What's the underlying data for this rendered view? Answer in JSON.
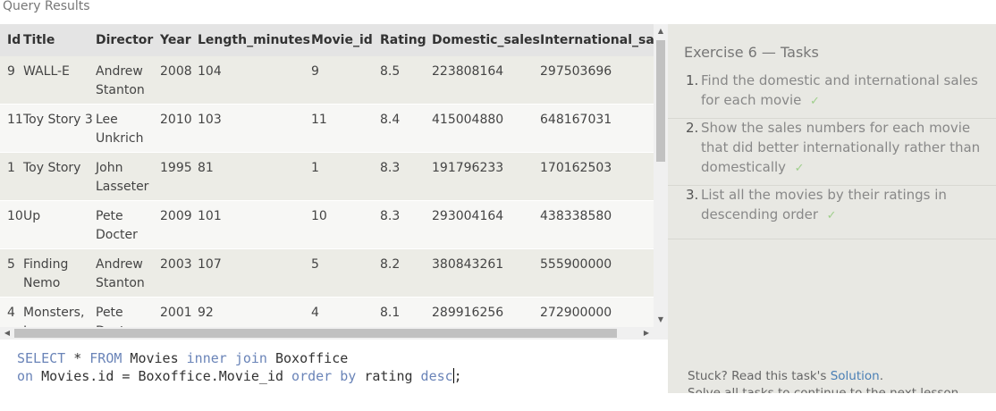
{
  "results": {
    "label": "Query Results",
    "columns": [
      "Id",
      "Title",
      "Director",
      "Year",
      "Length_minutes",
      "Movie_id",
      "Rating",
      "Domestic_sales",
      "International_sales"
    ],
    "rows": [
      [
        "9",
        "WALL-E",
        "Andrew Stanton",
        "2008",
        "104",
        "9",
        "8.5",
        "223808164",
        "297503696"
      ],
      [
        "11",
        "Toy Story 3",
        "Lee Unkrich",
        "2010",
        "103",
        "11",
        "8.4",
        "415004880",
        "648167031"
      ],
      [
        "1",
        "Toy Story",
        "John Lasseter",
        "1995",
        "81",
        "1",
        "8.3",
        "191796233",
        "170162503"
      ],
      [
        "10",
        "Up",
        "Pete Docter",
        "2009",
        "101",
        "10",
        "8.3",
        "293004164",
        "438338580"
      ],
      [
        "5",
        "Finding Nemo",
        "Andrew Stanton",
        "2003",
        "107",
        "5",
        "8.2",
        "380843261",
        "555900000"
      ],
      [
        "4",
        "Monsters, Inc.",
        "Pete Docter",
        "2001",
        "92",
        "4",
        "8.1",
        "289916256",
        "272900000"
      ]
    ]
  },
  "editor": {
    "line1": [
      {
        "t": "SELECT",
        "kw": true
      },
      {
        "t": " * ",
        "kw": false
      },
      {
        "t": "FROM",
        "kw": true
      },
      {
        "t": " Movies ",
        "kw": false
      },
      {
        "t": "inner join",
        "kw": true
      },
      {
        "t": " Boxoffice",
        "kw": false
      }
    ],
    "line2": [
      {
        "t": "on",
        "kw": true
      },
      {
        "t": " Movies.id = Boxoffice.Movie_id ",
        "kw": false
      },
      {
        "t": "order by",
        "kw": true
      },
      {
        "t": " rating ",
        "kw": false
      },
      {
        "t": "desc",
        "kw": true
      },
      {
        "t": ";",
        "kw": false
      }
    ]
  },
  "exercise": {
    "title": "Exercise 6 — Tasks",
    "tasks": [
      {
        "num": "1.",
        "text": "Find the domestic and international sales for each movie",
        "done": true
      },
      {
        "num": "2.",
        "text": "Show the sales numbers for each movie that did better internationally rather than domestically",
        "done": true
      },
      {
        "num": "3.",
        "text": "List all the movies by their ratings in descending order",
        "done": true
      }
    ],
    "check_mark": "✓",
    "stuck_text": "Stuck? Read this task's ",
    "solution_link": "Solution",
    "stuck_end": ".",
    "cutoff_text": "Solve all tasks to continue to the next lesson."
  },
  "colors": {
    "keyword": "#6a84b8",
    "check": "#9fcf8c",
    "link": "#4a7fb5"
  }
}
